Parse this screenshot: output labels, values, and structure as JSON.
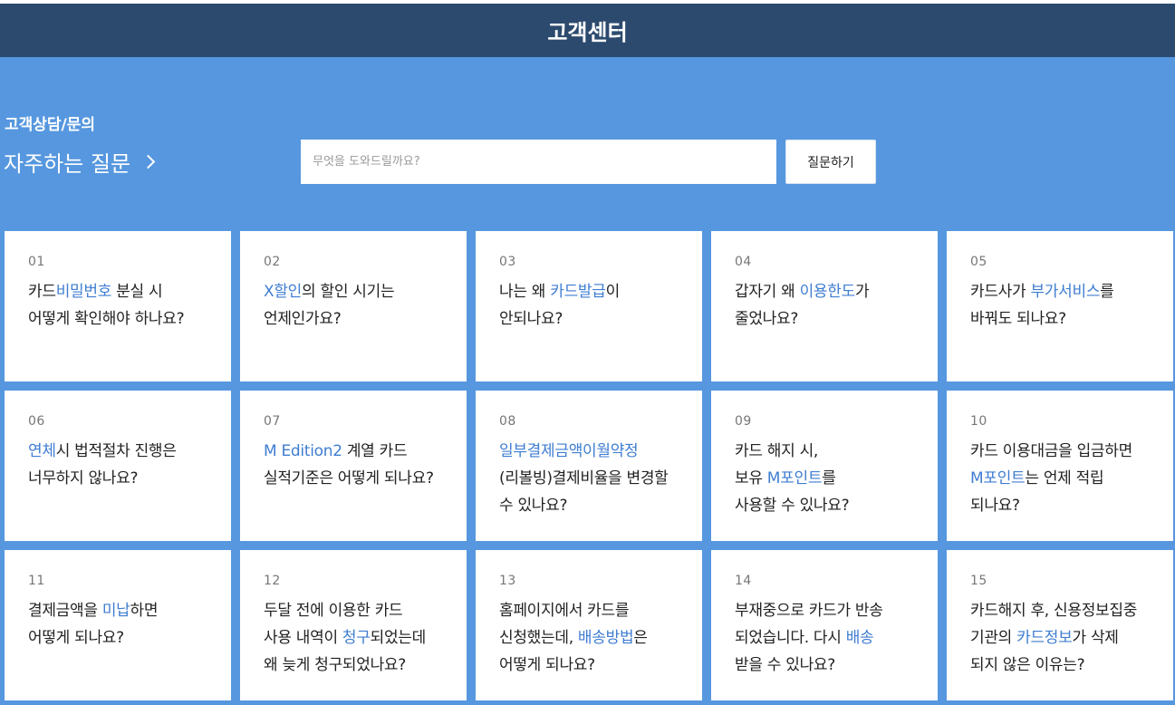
{
  "header": {
    "title": "고객센터"
  },
  "section": {
    "subtitle": "고객상담/문의",
    "faq_link_label": "자주하는 질문"
  },
  "search": {
    "placeholder": "무엇을 도와드릴까요?",
    "value": "",
    "button_label": "질문하기"
  },
  "colors": {
    "header_bg": "#2c4a6e",
    "main_bg": "#5697df",
    "highlight": "#3f7dd1"
  },
  "icons": {
    "faq_link": "chevron-right-icon"
  },
  "faq": [
    {
      "num": "01",
      "lines": [
        [
          {
            "t": "카드"
          },
          {
            "t": "비밀번호",
            "h": true
          },
          {
            "t": " 분실 시"
          }
        ],
        [
          {
            "t": "어떻게 확인해야 하나요?"
          }
        ]
      ]
    },
    {
      "num": "02",
      "lines": [
        [
          {
            "t": "X할인",
            "h": true
          },
          {
            "t": "의 할인 시기는"
          }
        ],
        [
          {
            "t": "언제인가요?"
          }
        ]
      ]
    },
    {
      "num": "03",
      "lines": [
        [
          {
            "t": "나는 왜 "
          },
          {
            "t": "카드발급",
            "h": true
          },
          {
            "t": "이"
          }
        ],
        [
          {
            "t": "안되나요?"
          }
        ]
      ]
    },
    {
      "num": "04",
      "lines": [
        [
          {
            "t": "갑자기 왜 "
          },
          {
            "t": "이용한도",
            "h": true
          },
          {
            "t": "가"
          }
        ],
        [
          {
            "t": "줄었나요?"
          }
        ]
      ]
    },
    {
      "num": "05",
      "lines": [
        [
          {
            "t": "카드사가 "
          },
          {
            "t": "부가서비스",
            "h": true
          },
          {
            "t": "를"
          }
        ],
        [
          {
            "t": "바꿔도 되나요?"
          }
        ]
      ]
    },
    {
      "num": "06",
      "lines": [
        [
          {
            "t": "연체",
            "h": true
          },
          {
            "t": "시 법적절차 진행은"
          }
        ],
        [
          {
            "t": "너무하지 않나요?"
          }
        ]
      ]
    },
    {
      "num": "07",
      "lines": [
        [
          {
            "t": "M Edition2",
            "h": true
          },
          {
            "t": " 계열 카드"
          }
        ],
        [
          {
            "t": "실적기준은 어떻게 되나요?"
          }
        ]
      ]
    },
    {
      "num": "08",
      "lines": [
        [
          {
            "t": "일부결제금액이월약정",
            "h": true
          }
        ],
        [
          {
            "t": "(리볼빙)결제비율을 변경할"
          }
        ],
        [
          {
            "t": "수 있나요?"
          }
        ]
      ]
    },
    {
      "num": "09",
      "lines": [
        [
          {
            "t": "카드 해지 시,"
          }
        ],
        [
          {
            "t": "보유 "
          },
          {
            "t": "M포인트",
            "h": true
          },
          {
            "t": "를"
          }
        ],
        [
          {
            "t": "사용할 수 있나요?"
          }
        ]
      ]
    },
    {
      "num": "10",
      "lines": [
        [
          {
            "t": "카드 이용대금을 입금하면"
          }
        ],
        [
          {
            "t": "M포인트",
            "h": true
          },
          {
            "t": "는 언제 적립"
          }
        ],
        [
          {
            "t": "되나요?"
          }
        ]
      ]
    },
    {
      "num": "11",
      "lines": [
        [
          {
            "t": "결제금액을 "
          },
          {
            "t": "미납",
            "h": true
          },
          {
            "t": "하면"
          }
        ],
        [
          {
            "t": "어떻게 되나요?"
          }
        ]
      ]
    },
    {
      "num": "12",
      "lines": [
        [
          {
            "t": "두달 전에 이용한 카드"
          }
        ],
        [
          {
            "t": "사용 내역이 "
          },
          {
            "t": "청구",
            "h": true
          },
          {
            "t": "되었는데"
          }
        ],
        [
          {
            "t": "왜 늦게 청구되었나요?"
          }
        ]
      ]
    },
    {
      "num": "13",
      "lines": [
        [
          {
            "t": "홈페이지에서 카드를"
          }
        ],
        [
          {
            "t": "신청했는데, "
          },
          {
            "t": "배송방법",
            "h": true
          },
          {
            "t": "은"
          }
        ],
        [
          {
            "t": "어떻게 되나요?"
          }
        ]
      ]
    },
    {
      "num": "14",
      "lines": [
        [
          {
            "t": "부재중으로 카드가 반송"
          }
        ],
        [
          {
            "t": "되었습니다. 다시 "
          },
          {
            "t": "배송",
            "h": true
          }
        ],
        [
          {
            "t": "받을 수 있나요?"
          }
        ]
      ]
    },
    {
      "num": "15",
      "lines": [
        [
          {
            "t": "카드해지 후, 신용정보집중"
          }
        ],
        [
          {
            "t": "기관의 "
          },
          {
            "t": "카드정보",
            "h": true
          },
          {
            "t": "가 삭제"
          }
        ],
        [
          {
            "t": "되지 않은 이유는?"
          }
        ]
      ]
    }
  ]
}
